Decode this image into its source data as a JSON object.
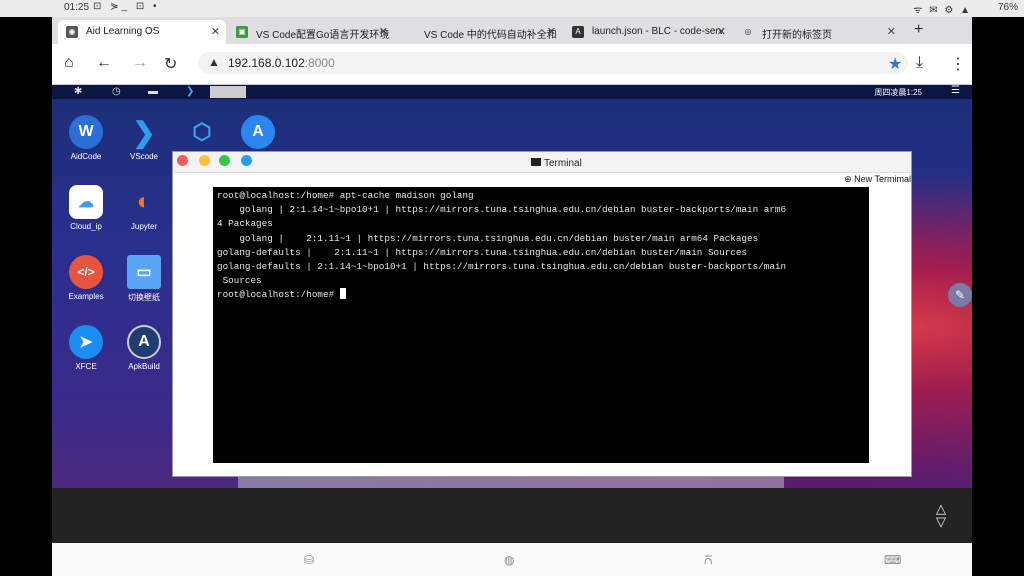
{
  "status_bar": {
    "time": "01:25",
    "notif_icons": "⊡ ⋟_ ⊡ •",
    "right_icons": "ᯤ ✉ ⚙ ▲",
    "battery": "76%"
  },
  "tabs": [
    {
      "label": "Aid Learning OS",
      "icon": "globe-icon"
    },
    {
      "label": "VS Code配置Go语言开发环境",
      "icon": "image-icon"
    },
    {
      "label": "VS Code 中的代码自动补全和",
      "icon": "bili-icon"
    },
    {
      "label": "launch.json - BLC - code-serv",
      "icon": "code-icon"
    },
    {
      "label": "打开新的标签页",
      "icon": "chrome-icon"
    }
  ],
  "address": {
    "host": "192.168.0.102",
    "port": ":8000"
  },
  "desktop": {
    "clock": "周四凌晨1:25",
    "icons": [
      {
        "label": "AidCode",
        "color": "#2a6fd6",
        "glyph": "W"
      },
      {
        "label": "VScode",
        "color": "#1f8ad2",
        "glyph": "❯"
      },
      {
        "label": "Cloud_ip",
        "color": "#ffffff",
        "glyph": "☁"
      },
      {
        "label": "Jupyter",
        "color": "#2c2c7a",
        "glyph": "◐"
      },
      {
        "label": "Examples",
        "color": "#e8553e",
        "glyph": "</>"
      },
      {
        "label": "切换壁纸",
        "color": "#56a6f5",
        "glyph": "▭"
      },
      {
        "label": "XFCE",
        "color": "#1a8df0",
        "glyph": "➤"
      },
      {
        "label": "ApkBuild",
        "color": "#1e3d70",
        "glyph": "A"
      }
    ]
  },
  "terminal": {
    "title": "Terminal",
    "new_terminal": "New Termimal",
    "lines": [
      "root@localhost:/home# apt-cache madison golang",
      "    golang | 2:1.14~1~bpo10+1 | https://mirrors.tuna.tsinghua.edu.cn/debian buster-backports/main arm6",
      "4 Packages",
      "    golang |    2:1.11~1 | https://mirrors.tuna.tsinghua.edu.cn/debian buster/main arm64 Packages",
      "golang-defaults |    2:1.11~1 | https://mirrors.tuna.tsinghua.edu.cn/debian buster/main Sources",
      "golang-defaults | 2:1.14~1~bpo10+1 | https://mirrors.tuna.tsinghua.edu.cn/debian buster-backports/main",
      " Sources"
    ],
    "prompt": "root@localhost:/home# "
  }
}
